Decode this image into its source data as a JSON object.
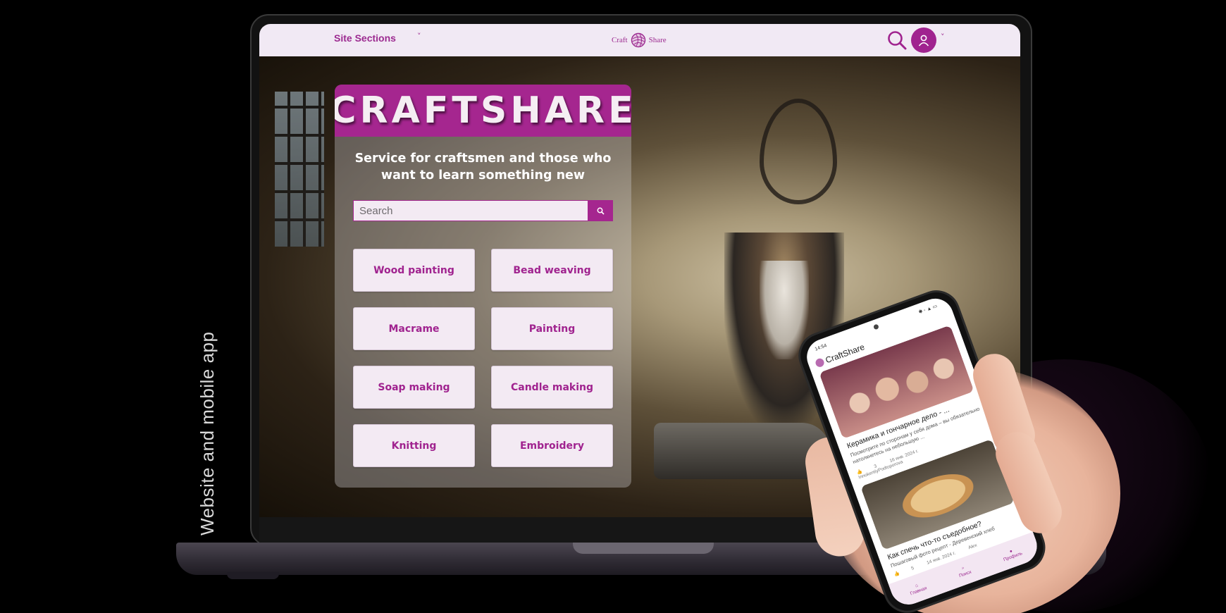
{
  "caption": "Website and mobile app",
  "nav": {
    "sections_label": "Site Sections",
    "chevron": "˅",
    "logo_left": "Craft",
    "logo_right": "Share",
    "avatar_chevron": "˅"
  },
  "hero": {
    "title": "CRAFTSHARE",
    "subtitle": "Service for craftsmen and those who want to learn something new",
    "search_placeholder": "Search"
  },
  "categories": [
    "Wood painting",
    "Bead weaving",
    "Macrame",
    "Painting",
    "Soap making",
    "Candle making",
    "Knitting",
    "Embroidery"
  ],
  "phone": {
    "time": "14:54",
    "status_icons": "✱ ◦ ▲ ▭",
    "app_name": "CraftShare",
    "cards": [
      {
        "title": "Керамика и гончарное дело - ...",
        "desc": "Посмотрите по сторонам у себя дома – вы обязательно натолкнетесь на небольшую ...",
        "likes": "3",
        "date": "16 янв. 2024 г.",
        "author": "InnokentiyPodtoporova"
      },
      {
        "title": "Как спечь что-то съедобное?",
        "desc": "Пошаговый фото рецепт - Деревенский хлеб",
        "likes": "5",
        "date": "14 янв. 2024 г.",
        "author": "Alex"
      }
    ],
    "tabs": [
      "Главная",
      "Поиск",
      "Профиль"
    ]
  },
  "colors": {
    "brand": "#a5268f",
    "nav_bg": "#f1e9f4",
    "button_bg": "#f3eaf3"
  }
}
